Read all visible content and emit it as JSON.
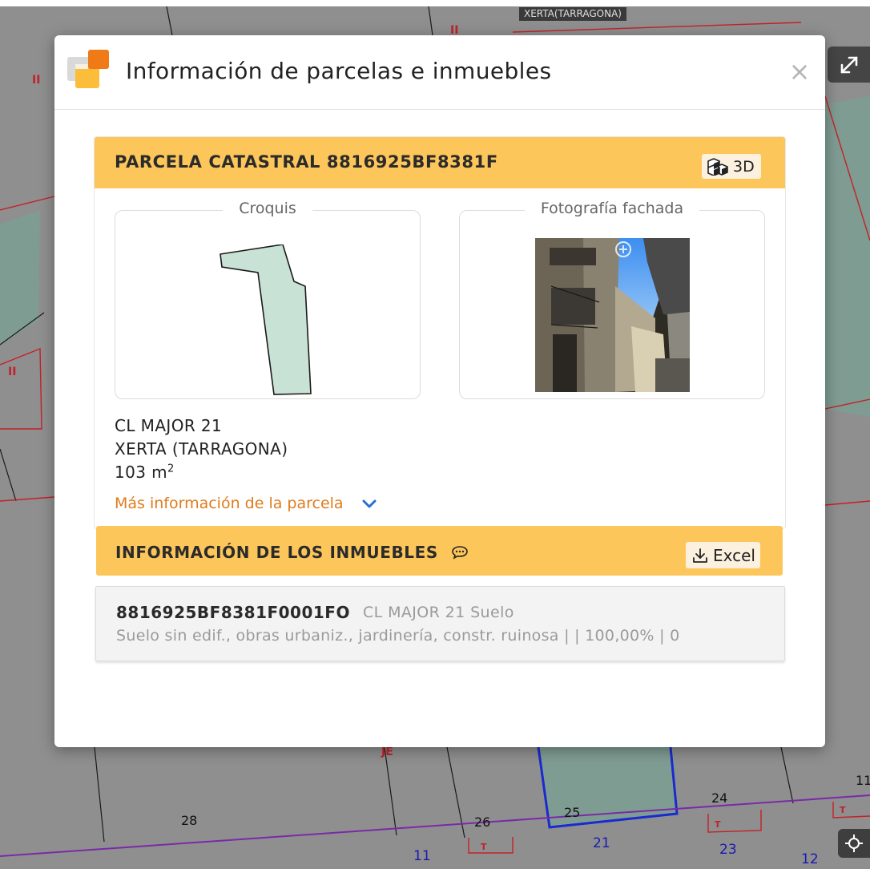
{
  "map": {
    "title": "XERTA(TARRAGONA)",
    "numbers": [
      "28",
      "26",
      "25",
      "24",
      "11",
      "21",
      "23",
      "11",
      "12",
      "II",
      "II",
      "II",
      "JE",
      "T",
      "T",
      "T"
    ]
  },
  "modal": {
    "title": "Información de parcelas e inmuebles",
    "close_label": "×"
  },
  "parcel": {
    "header": "PARCELA CATASTRAL 8816925BF8381F",
    "btn_3d_label": "3D",
    "croquis_legend": "Croquis",
    "foto_legend": "Fotografía fachada",
    "address_street": "CL MAJOR 21",
    "address_city": "XERTA (TARRAGONA)",
    "area_value": "103 m",
    "area_unit_sup": "2",
    "more_info": "Más información de la parcela"
  },
  "inmuebles": {
    "header": "INFORMACIÓN DE LOS INMUEBLES",
    "excel_label": "Excel",
    "items": [
      {
        "ref": "8816925BF8381F0001FO",
        "address": "CL MAJOR 21 Suelo",
        "description": "Suelo sin edif., obras urbaniz., jardinería, constr. ruinosa | | 100,00% | 0"
      }
    ]
  },
  "colors": {
    "accent_header": "#fdc65a",
    "link_orange": "#e07b1c",
    "chevron_blue": "#2a6fd6",
    "parcel_fill": "#c9e2d6"
  }
}
